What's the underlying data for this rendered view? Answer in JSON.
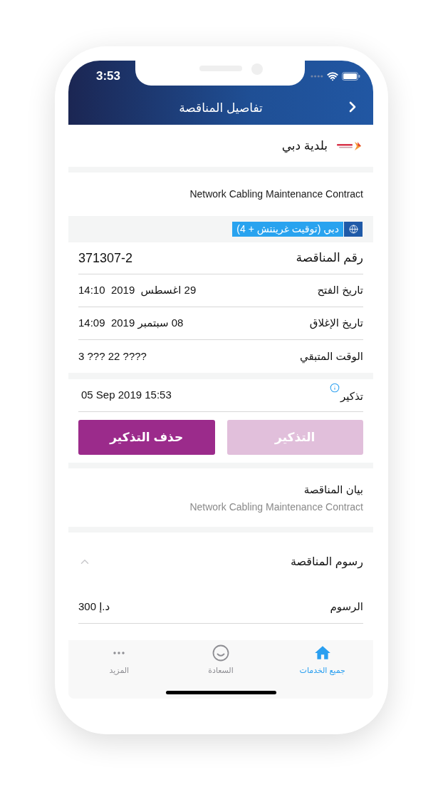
{
  "status_bar": {
    "time": "3:53"
  },
  "header": {
    "title": "تفاصيل المناقصة"
  },
  "entity": {
    "name": "بلدية دبي"
  },
  "tender_title": "Network Cabling Maintenance Contract",
  "timezone": {
    "label": "دبي (توقيت غرينتش + 4)"
  },
  "tender_number": {
    "label": "رقم المناقصة",
    "value": "371307-2"
  },
  "details": [
    {
      "label": "تاريخ الفتح",
      "value": "29 اغسطس  2019  14:10"
    },
    {
      "label": "تاريخ الإغلاق",
      "value": "08 سبتمبر 2019  14:09"
    },
    {
      "label": "الوقت المتبقي",
      "value": "3 ??? 22 ????"
    }
  ],
  "reminder": {
    "label": "تذكير",
    "value": "05 Sep 2019 15:53"
  },
  "buttons": [
    {
      "label": "التذكير",
      "disabled": true
    },
    {
      "label": "حذف التذكير",
      "disabled": false
    }
  ],
  "description": {
    "label": "بيان المناقصة",
    "value": "Network Cabling Maintenance Contract"
  },
  "fees": {
    "title": "رسوم المناقصة",
    "expanded": true,
    "rows": [
      {
        "label": "الرسوم",
        "value": "د.إ 300"
      }
    ]
  },
  "tab_bar": [
    {
      "label": "جميع الخدمات",
      "selected": true
    },
    {
      "label": "السعادة",
      "selected": false
    },
    {
      "label": "المزيد",
      "selected": false
    }
  ]
}
